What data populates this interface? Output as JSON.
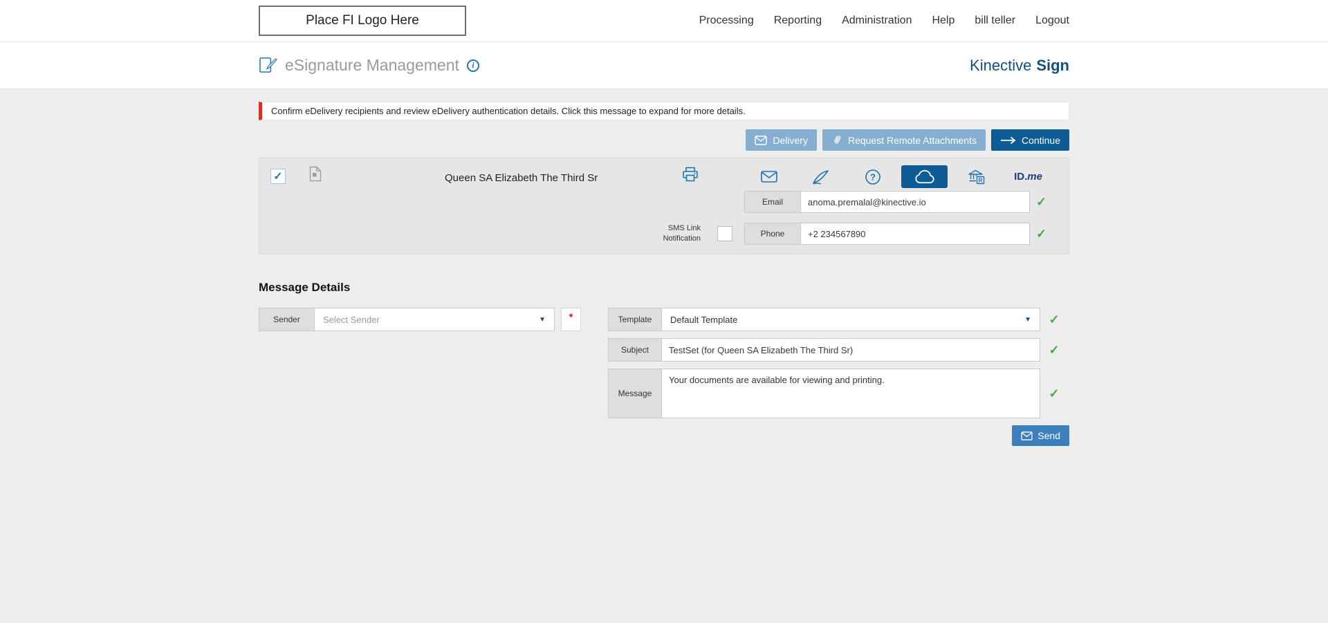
{
  "topbar": {
    "logo_placeholder": "Place FI Logo Here",
    "nav": [
      "Processing",
      "Reporting",
      "Administration",
      "Help",
      "bill teller",
      "Logout"
    ]
  },
  "subheader": {
    "title": "eSignature Management",
    "brand": {
      "name": "Kinective",
      "product": "Sign"
    }
  },
  "alert": {
    "text": "Confirm eDelivery recipients and review eDelivery authentication details. Click this message to expand for more details."
  },
  "toolbar": {
    "delivery_label": "Delivery",
    "request_remote_label": "Request Remote Attachments",
    "continue_label": "Continue"
  },
  "recipient": {
    "name": "Queen SA Elizabeth The Third Sr",
    "email": {
      "label": "Email",
      "value": "anoma.premalal@kinective.io"
    },
    "sms": {
      "label_line1": "SMS Link",
      "label_line2": "Notification"
    },
    "phone": {
      "label": "Phone",
      "value": "+2 234567890"
    },
    "idme": {
      "id": "ID.",
      "me": "me"
    }
  },
  "message_details": {
    "heading": "Message Details",
    "sender": {
      "label": "Sender",
      "placeholder": "Select Sender",
      "required": "*"
    },
    "template": {
      "label": "Template",
      "value": "Default Template"
    },
    "subject": {
      "label": "Subject",
      "value": "TestSet (for Queen SA Elizabeth The Third Sr)"
    },
    "message": {
      "label": "Message",
      "value": "Your documents are available for viewing and printing."
    },
    "send_label": "Send"
  },
  "icons": {
    "check": "✓",
    "dropdown": "▼",
    "info": "i",
    "question_mark": "?",
    "remote_badge": "R"
  },
  "colors": {
    "accent_blue": "#1e72ad",
    "dark_blue": "#0e5c95",
    "light_blue_button": "#85aed1",
    "send_blue": "#3d7ebd",
    "brand_navy": "#14507c",
    "success_green": "#4aa44a",
    "alert_red": "#d0342c"
  }
}
